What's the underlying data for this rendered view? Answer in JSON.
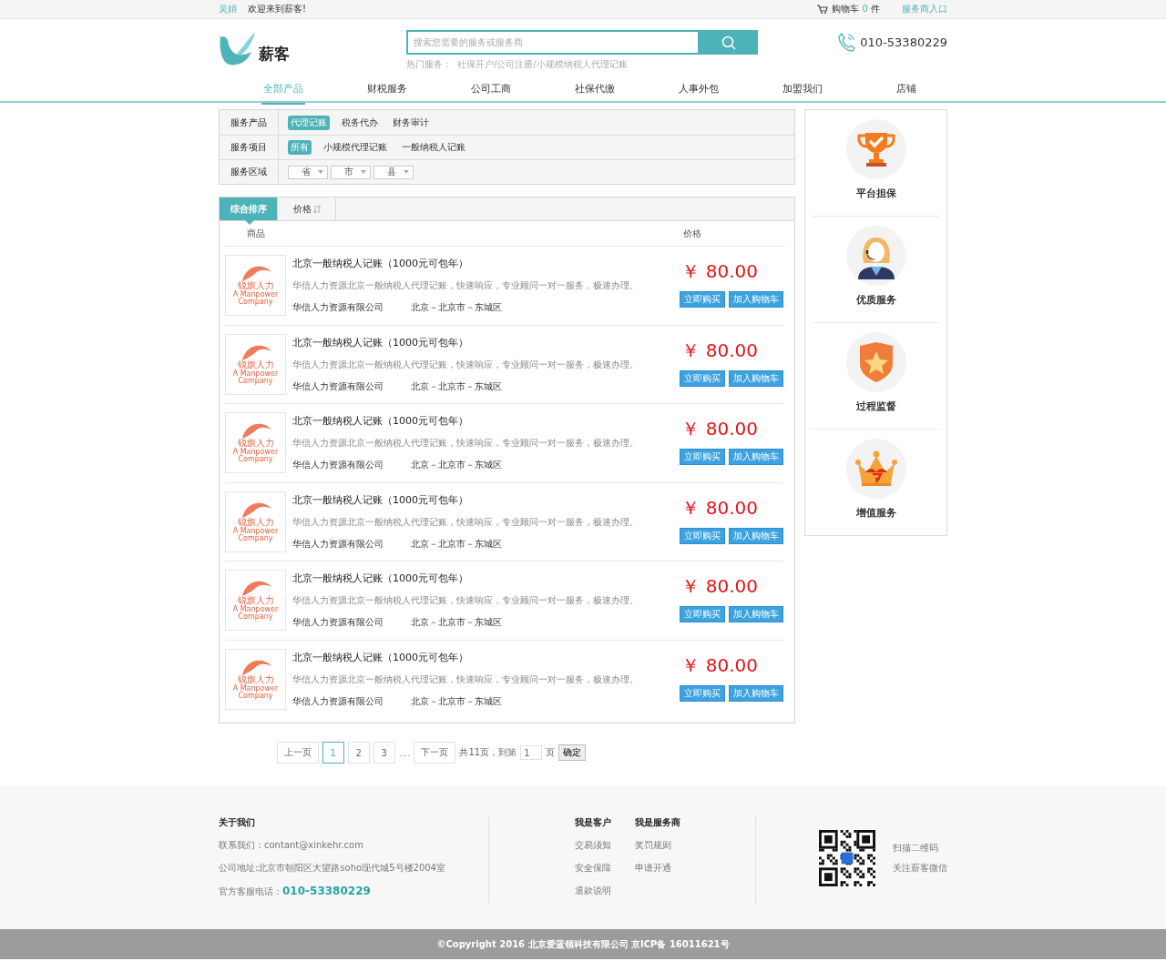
{
  "top_bar": {
    "user": "吴娟",
    "welcome": "欢迎来到薪客!",
    "cart_label": "购物车",
    "cart_count": "0",
    "cart_unit": "件",
    "provider_link": "服务商入口"
  },
  "header": {
    "logo_text": "薪客",
    "search": {
      "placeholder": "搜索您需要的服务或服务商",
      "hot_label": "热门服务：",
      "hot_links": "社保开户/公司注册/小规模纳税人代理记账"
    },
    "phone": "010-53380229"
  },
  "nav": [
    {
      "label": "全部产品",
      "selected": true
    },
    {
      "label": "财税服务",
      "selected": false
    },
    {
      "label": "公司工商",
      "selected": false
    },
    {
      "label": "社保代缴",
      "selected": false
    },
    {
      "label": "人事外包",
      "selected": false
    },
    {
      "label": "加盟我们",
      "selected": false
    },
    {
      "label": "店铺",
      "selected": false
    }
  ],
  "filters": [
    {
      "label": "服务产品",
      "kind": "options",
      "options": [
        {
          "label": "代理记账",
          "selected": true
        },
        {
          "label": "税务代办",
          "selected": false
        },
        {
          "label": "财务审计",
          "selected": false
        }
      ]
    },
    {
      "label": "服务项目",
      "kind": "options",
      "options": [
        {
          "label": "所有",
          "selected": true
        },
        {
          "label": "小规模代理记账",
          "selected": false
        },
        {
          "label": "一般纳税人记账",
          "selected": false
        }
      ]
    },
    {
      "label": "服务区域",
      "kind": "selects",
      "selects": [
        "省",
        "市",
        "县"
      ]
    }
  ],
  "sort_tabs": [
    {
      "label": "综合排序",
      "selected": true
    },
    {
      "label": "价格",
      "selected": false
    }
  ],
  "columns": [
    "商品",
    "价格"
  ],
  "products": [
    {
      "logo_name": "锐旗人力",
      "logo_tagline": "A Manpower Company",
      "title": "北京一般纳税人记账（1000元可包年）",
      "description": "华信人力资源北京一般纳税人代理记账，快速响应，专业顾问一对一服务，极速办理。",
      "company": "华信人力资源有限公司",
      "location": "北京－北京市－东城区",
      "price": "￥ 80.00",
      "buy": "立即购买",
      "add_cart": "加入购物车"
    },
    {
      "logo_name": "锐旗人力",
      "logo_tagline": "A Manpower Company",
      "title": "北京一般纳税人记账（1000元可包年）",
      "description": "华信人力资源北京一般纳税人代理记账，快速响应，专业顾问一对一服务，极速办理。",
      "company": "华信人力资源有限公司",
      "location": "北京－北京市－东城区",
      "price": "￥ 80.00",
      "buy": "立即购买",
      "add_cart": "加入购物车"
    },
    {
      "logo_name": "锐旗人力",
      "logo_tagline": "A Manpower Company",
      "title": "北京一般纳税人记账（1000元可包年）",
      "description": "华信人力资源北京一般纳税人代理记账，快速响应，专业顾问一对一服务，极速办理。",
      "company": "华信人力资源有限公司",
      "location": "北京－北京市－东城区",
      "price": "￥ 80.00",
      "buy": "立即购买",
      "add_cart": "加入购物车"
    },
    {
      "logo_name": "锐旗人力",
      "logo_tagline": "A Manpower Company",
      "title": "北京一般纳税人记账（1000元可包年）",
      "description": "华信人力资源北京一般纳税人代理记账，快速响应，专业顾问一对一服务，极速办理。",
      "company": "华信人力资源有限公司",
      "location": "北京－北京市－东城区",
      "price": "￥ 80.00",
      "buy": "立即购买",
      "add_cart": "加入购物车"
    },
    {
      "logo_name": "锐旗人力",
      "logo_tagline": "A Manpower Company",
      "title": "北京一般纳税人记账（1000元可包年）",
      "description": "华信人力资源北京一般纳税人代理记账，快速响应，专业顾问一对一服务，极速办理。",
      "company": "华信人力资源有限公司",
      "location": "北京－北京市－东城区",
      "price": "￥ 80.00",
      "buy": "立即购买",
      "add_cart": "加入购物车"
    },
    {
      "logo_name": "锐旗人力",
      "logo_tagline": "A Manpower Company",
      "title": "北京一般纳税人记账（1000元可包年）",
      "description": "华信人力资源北京一般纳税人代理记账，快速响应，专业顾问一对一服务，极速办理。",
      "company": "华信人力资源有限公司",
      "location": "北京－北京市－东城区",
      "price": "￥ 80.00",
      "buy": "立即购买",
      "add_cart": "加入购物车"
    }
  ],
  "pagination": {
    "prev": "上一页",
    "pages": [
      {
        "label": "1",
        "selected": true
      },
      {
        "label": "2",
        "selected": false
      },
      {
        "label": "3",
        "selected": false
      }
    ],
    "ellipsis": "....",
    "next": "下一页",
    "total": "共11页，到第",
    "page_input": "1",
    "unit": "页",
    "confirm": "确定"
  },
  "sidebar": [
    {
      "kind": "trophy",
      "label": "平台担保"
    },
    {
      "kind": "agent",
      "label": "优质服务"
    },
    {
      "kind": "shield",
      "label": "过程监督"
    },
    {
      "kind": "crown",
      "label": "增值服务"
    }
  ],
  "footer": {
    "about": {
      "title": "关于我们",
      "email": "联系我们：contant@xinkehr.com",
      "address": "公司地址:北京市朝阳区大望路soho现代城5号楼2004室",
      "phone_label": "官方客服电话：",
      "phone": "010-53380229"
    },
    "customer": {
      "title": "我是客户",
      "links": [
        "交易须知",
        "安全保障",
        "退款说明"
      ]
    },
    "provider": {
      "title": "我是服务商",
      "links": [
        "奖罚规则",
        "申请开通"
      ]
    },
    "qr_lines": [
      "扫描二维码",
      "关注薪客微信"
    ]
  },
  "copyright": "©Copyright 2016 北京爱蓝领科技有限公司 京ICP备 16011621号"
}
